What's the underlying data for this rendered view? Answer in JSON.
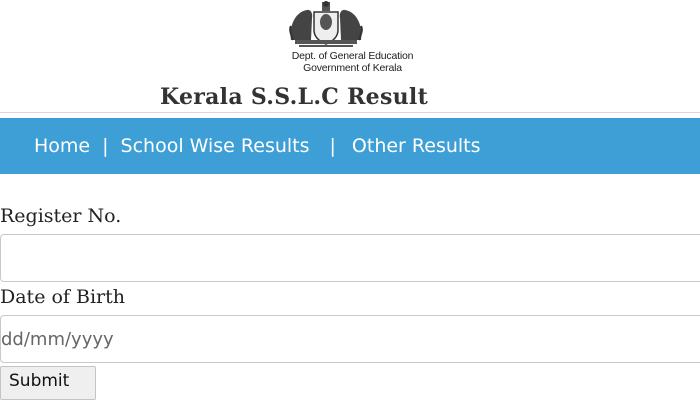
{
  "header": {
    "emblem_icon": "kerala-state-emblem",
    "dept_line1": "Dept. of General Education",
    "dept_line2": "Government of Kerala",
    "title": "Kerala S.S.L.C Result"
  },
  "nav": {
    "background": "#3e9fd6",
    "items": [
      {
        "label": "Home"
      },
      {
        "label": "School Wise Results"
      },
      {
        "label": "Other Results"
      }
    ],
    "separator": "|"
  },
  "form": {
    "register_label": "Register No.",
    "register_value": "",
    "register_placeholder": "",
    "dob_label": "Date of Birth",
    "dob_value": "",
    "dob_placeholder": "dd/mm/yyyy",
    "submit_label": "Submit"
  }
}
